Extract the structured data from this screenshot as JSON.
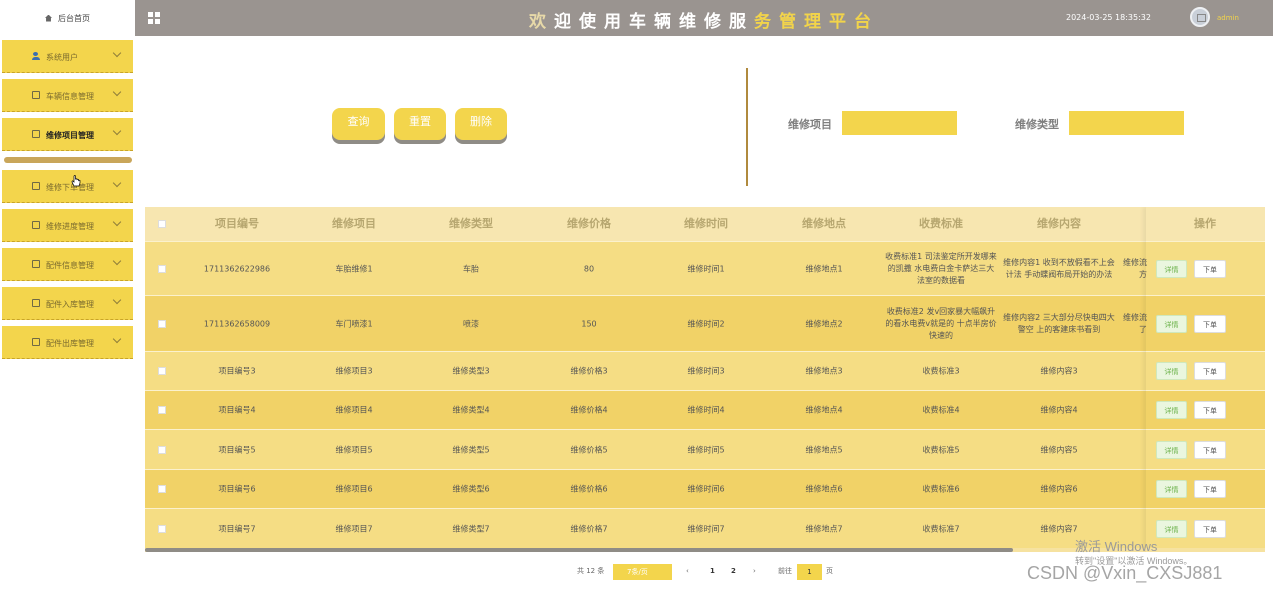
{
  "sidebar": {
    "home": "后台首页",
    "items": [
      {
        "label": "系统用户",
        "icon": "user-icon"
      },
      {
        "label": "车辆信息管理",
        "icon": "document-icon"
      },
      {
        "label": "维修项目管理",
        "icon": "document-icon",
        "active": true
      },
      {
        "label": "维修下单管理",
        "icon": "document-icon"
      },
      {
        "label": "维修进度管理",
        "icon": "document-icon"
      },
      {
        "label": "配件信息管理",
        "icon": "document-icon"
      },
      {
        "label": "配件入库管理",
        "icon": "document-icon"
      },
      {
        "label": "配件出库管理",
        "icon": "document-icon"
      }
    ]
  },
  "header": {
    "title": "欢迎使用车辆维修服务管理平台",
    "datetime": "2024-03-25 18:35:32",
    "username": "admin"
  },
  "toolbar": {
    "query": "查询",
    "reset": "重置",
    "delete": "删除"
  },
  "filters": {
    "project_label": "维修项目",
    "project_value": "",
    "type_label": "维修类型",
    "type_value": ""
  },
  "table": {
    "headers": [
      "项目编号",
      "维修项目",
      "维修类型",
      "维修价格",
      "维修时间",
      "维修地点",
      "收费标准",
      "维修内容",
      "操作"
    ],
    "rows": [
      {
        "id": "1711362622986",
        "project": "车胎维修1",
        "type": "车胎",
        "price": "80",
        "time": "维修时间1",
        "place": "维修地点1",
        "standard": "收费标准1 司法鉴定所开发哪来的凯撒 水电费白金卡萨达三大法室的数据看",
        "content": "维修内容1 收到不放假看不上会计法 手动蝶阀布局开始的办法",
        "extra": "维修流方"
      },
      {
        "id": "1711362658009",
        "project": "车门喷漆1",
        "type": "喷漆",
        "price": "150",
        "time": "维修时间2",
        "place": "维修地点2",
        "standard": "收费标准2 发v回家暴大幅飙升的看水电费v就是的 十点半房价快速的",
        "content": "维修内容2 三大部分尽快电四大警空 上的客建床书看到",
        "extra": "维修流了"
      },
      {
        "id": "项目编号3",
        "project": "维修项目3",
        "type": "维修类型3",
        "price": "维修价格3",
        "time": "维修时间3",
        "place": "维修地点3",
        "standard": "收费标准3",
        "content": "维修内容3",
        "extra": ""
      },
      {
        "id": "项目编号4",
        "project": "维修项目4",
        "type": "维修类型4",
        "price": "维修价格4",
        "time": "维修时间4",
        "place": "维修地点4",
        "standard": "收费标准4",
        "content": "维修内容4",
        "extra": ""
      },
      {
        "id": "项目编号5",
        "project": "维修项目5",
        "type": "维修类型5",
        "price": "维修价格5",
        "time": "维修时间5",
        "place": "维修地点5",
        "standard": "收费标准5",
        "content": "维修内容5",
        "extra": ""
      },
      {
        "id": "项目编号6",
        "project": "维修项目6",
        "type": "维修类型6",
        "price": "维修价格6",
        "time": "维修时间6",
        "place": "维修地点6",
        "standard": "收费标准6",
        "content": "维修内容6",
        "extra": ""
      },
      {
        "id": "项目编号7",
        "project": "维修项目7",
        "type": "维修类型7",
        "price": "维修价格7",
        "time": "维修时间7",
        "place": "维修地点7",
        "standard": "收费标准7",
        "content": "维修内容7",
        "extra": ""
      }
    ],
    "detail_label": "详情",
    "order_label": "下单"
  },
  "pagination": {
    "total": "共 12 条",
    "page_size": "7条/页",
    "prev": "‹",
    "page1": "1",
    "page2": "2",
    "next": "›",
    "goto_label": "前往",
    "goto_value": "1",
    "page_suffix": "页"
  },
  "overlay": {
    "activate_windows": "激活 Windows",
    "activate_hint": "转到\"设置\"以激活 Windows。",
    "csdn": "CSDN @Vxin_CXSJ881"
  },
  "colors": {
    "accent": "#f3d54c",
    "header_bg": "#9a9490",
    "row_a": "#f5dd84",
    "row_b": "#f1d267"
  }
}
